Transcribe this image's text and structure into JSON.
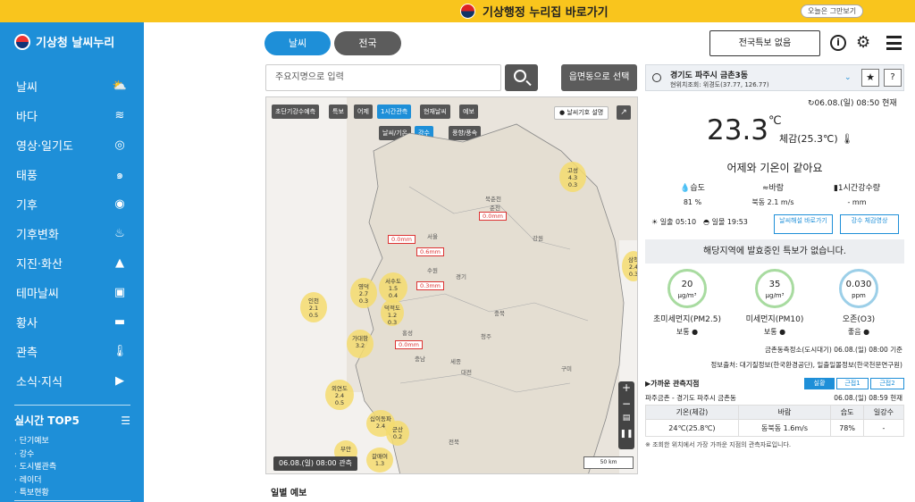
{
  "topbar": {
    "title": "기상행정 누리집 바로가기",
    "close_label": "오늘은 그만보기"
  },
  "sidebar": {
    "logo_text": "기상청 날씨누리",
    "items": [
      {
        "label": "날씨",
        "icon": "cloud-sun-icon"
      },
      {
        "label": "바다",
        "icon": "wave-icon"
      },
      {
        "label": "영상·일기도",
        "icon": "globe-icon"
      },
      {
        "label": "태풍",
        "icon": "typhoon-icon"
      },
      {
        "label": "기후",
        "icon": "climate-icon"
      },
      {
        "label": "기후변화",
        "icon": "heat-icon"
      },
      {
        "label": "지진·화산",
        "icon": "volcano-icon"
      },
      {
        "label": "테마날씨",
        "icon": "bag-icon"
      },
      {
        "label": "황사",
        "icon": "dust-icon"
      },
      {
        "label": "관측",
        "icon": "thermometer-icon"
      },
      {
        "label": "소식·지식",
        "icon": "video-icon"
      }
    ],
    "top5_title": "실시간 TOP5",
    "top5": [
      "· 단기예보",
      "· 강수",
      "· 도시별관측",
      "· 레이더",
      "· 특보현황"
    ]
  },
  "tabs": {
    "weather": "날씨",
    "nation": "전국"
  },
  "search": {
    "placeholder": "주요지명으로 입력",
    "select_label": "읍면동으로 선택"
  },
  "map": {
    "buttons": [
      "초단기강수예측",
      "특보",
      "어제",
      "1시간관측",
      "현재날씨",
      "예보"
    ],
    "sub_buttons": [
      "날씨/기온",
      "강수",
      "풍향/풍속"
    ],
    "legend_label": "날씨기호 설명",
    "timestamp": "06.08.(일) 08:00 관측",
    "scale": "50 km",
    "bubbles": [
      {
        "name": "고성",
        "t": "4.3",
        "r": "0.3"
      },
      {
        "name": "영덕",
        "t": "2.7",
        "r": "0.3"
      },
      {
        "name": "서수도",
        "t": "1.5",
        "r": "0.4"
      },
      {
        "name": "인천",
        "t": "2.1",
        "r": "0.5"
      },
      {
        "name": "덕적도",
        "t": "1.2",
        "r": "0.3"
      },
      {
        "name": "가대항",
        "t": "3.2",
        "r": ""
      },
      {
        "name": "외연도",
        "t": "2.4",
        "r": "0.5"
      },
      {
        "name": "십이동파",
        "t": "2.4",
        "r": ""
      },
      {
        "name": "군산",
        "t": "0.2",
        "r": ""
      },
      {
        "name": "부안",
        "t": "",
        "r": ""
      },
      {
        "name": "갈매여",
        "t": "1.3",
        "r": ""
      },
      {
        "name": "삼척",
        "t": "2.4",
        "r": "0.3"
      }
    ],
    "rain_labels": [
      "0.0mm",
      "0.0mm",
      "0.6mm",
      "0.3mm",
      "0.0mm"
    ],
    "cities": [
      "북춘천",
      "춘천",
      "강원",
      "서울",
      "수원",
      "경기",
      "충북",
      "충남",
      "세종",
      "대전",
      "청주",
      "홍성",
      "전북",
      "구미"
    ]
  },
  "daily_title": "일별 예보",
  "header": {
    "alert_label": "전국특보 없음"
  },
  "location": {
    "name": "경기도 파주시 금촌3동",
    "coord": "현위치조회: 위경도(37.77, 126.77)"
  },
  "obs_time": "06.08.(일) 08:50 현재",
  "current": {
    "temp": "23.3",
    "unit": "℃",
    "feels": "체감(25.3℃)",
    "compare": "어제와 기온이 같아요"
  },
  "stats": [
    {
      "label": "습도",
      "value": "81 %"
    },
    {
      "label": "바람",
      "value": "북동 2.1 m/s"
    },
    {
      "label": "1시간강수량",
      "value": "- mm"
    }
  ],
  "sun": {
    "sunrise": "일출 05:10",
    "sunset": "일몰 19:53",
    "btn1": "날씨해설 바로가기",
    "btn2": "강수 체감영상"
  },
  "no_warning": "해당지역에 발효중인 특보가 없습니다.",
  "air": [
    {
      "value": "20",
      "unit": "μg/m³",
      "name": "초미세먼지(PM2.5)",
      "status": "보통"
    },
    {
      "value": "35",
      "unit": "μg/m³",
      "name": "미세먼지(PM10)",
      "status": "보통"
    },
    {
      "value": "0.030",
      "unit": "ppm",
      "name": "오존(O3)",
      "status": "좋음"
    }
  ],
  "station": "금촌동측정소(도시대기) 06.08.(일) 08:00 기준",
  "source": "정보출처: 대기질정보(한국환경공단), 일출일몰정보(한국천문연구원)",
  "near": {
    "title": "▶가까운 관측지점",
    "tabs": [
      "실황",
      "근접1",
      "근접2"
    ],
    "location": "파주금촌 - 경기도 파주시 금촌동",
    "time": "06.08.(일) 08:59 현재",
    "headers": [
      "기온(체감)",
      "바람",
      "습도",
      "일강수"
    ],
    "row": [
      "24℃(25.8℃)",
      "동북동 1.6m/s",
      "78%",
      "-"
    ],
    "note": "※ 조회한 위치에서 가장 가까운 지점의 관측자료입니다."
  }
}
